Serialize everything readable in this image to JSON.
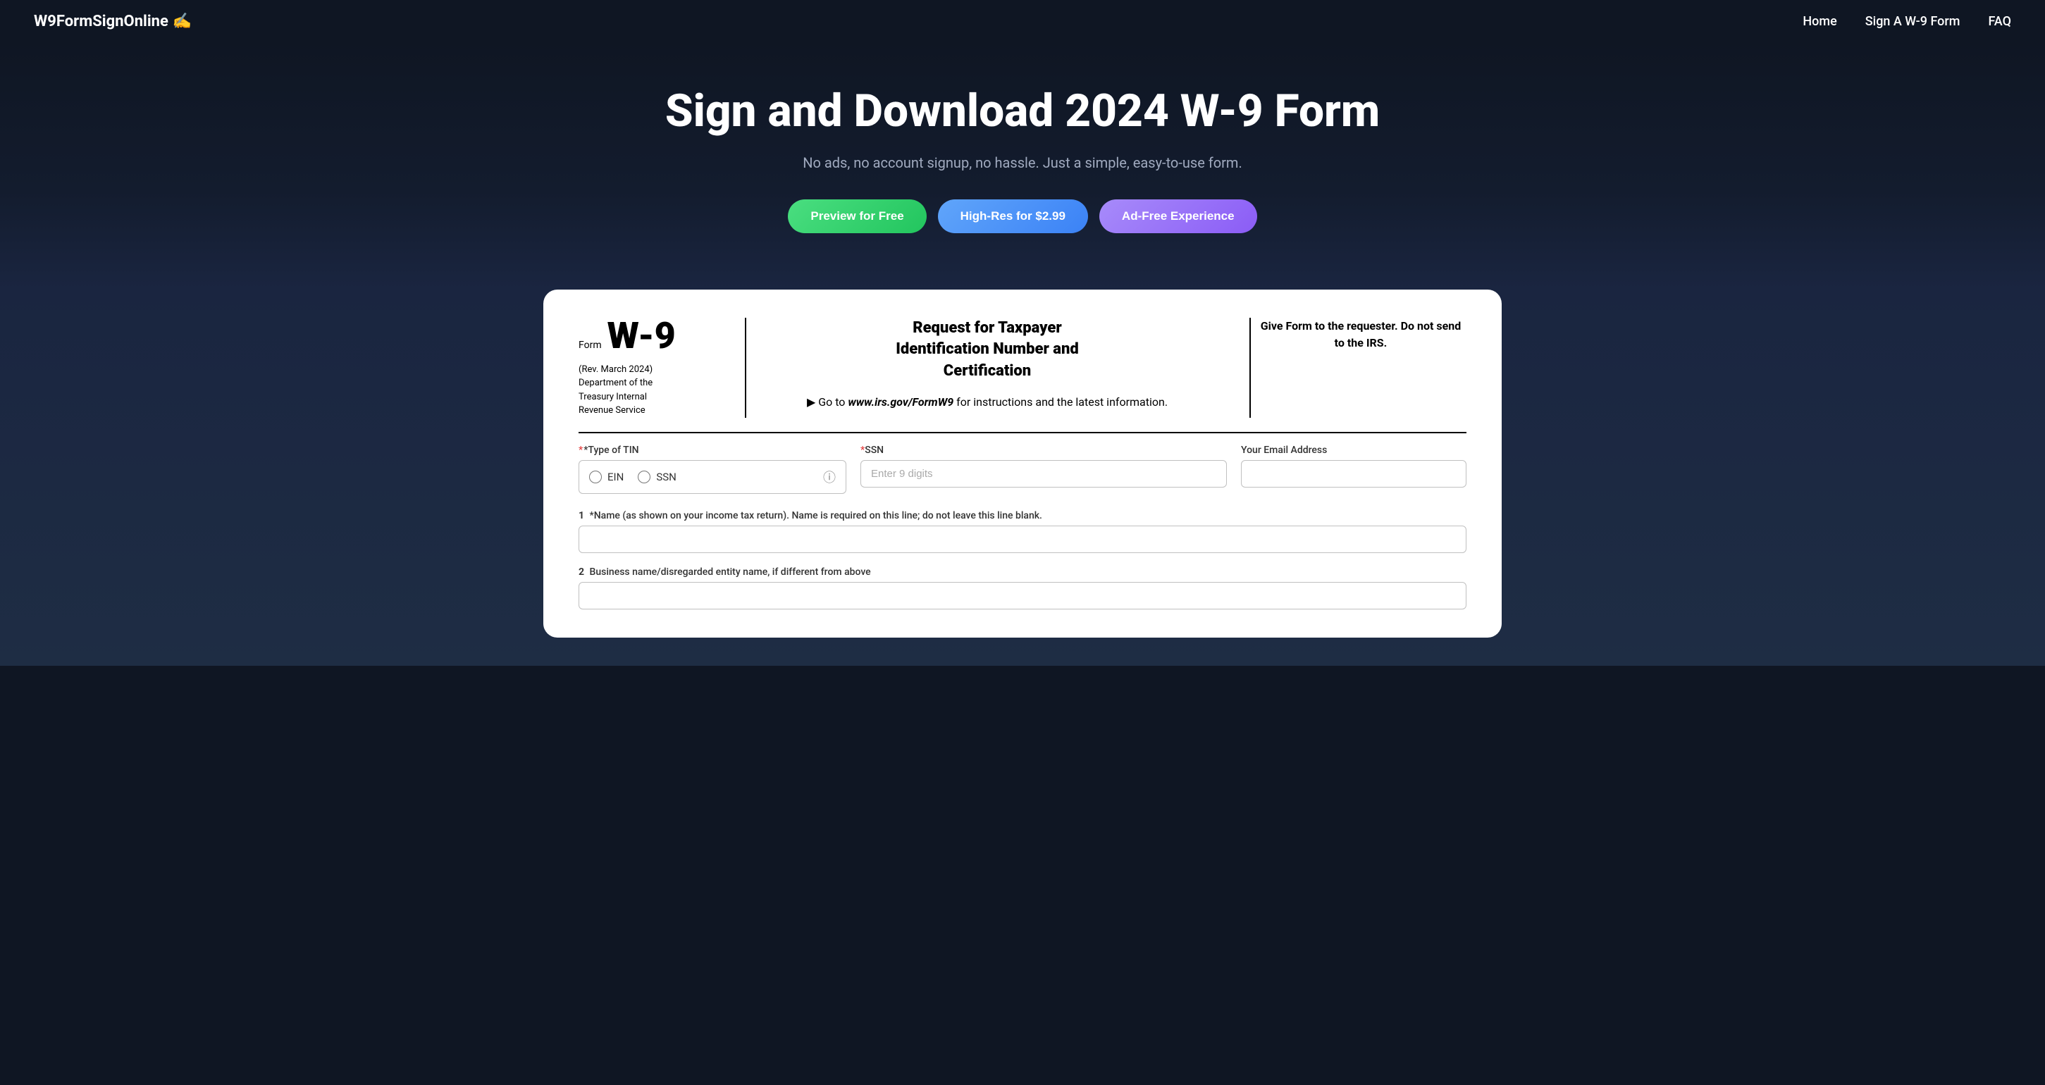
{
  "nav": {
    "logo_text": "W9FormSignOnline",
    "logo_icon": "✍️",
    "links": [
      {
        "label": "Home",
        "href": "#"
      },
      {
        "label": "Sign A W-9 Form",
        "href": "#"
      },
      {
        "label": "FAQ",
        "href": "#"
      }
    ]
  },
  "hero": {
    "title": "Sign and Download 2024 W-9 Form",
    "subtitle": "No ads, no account signup, no hassle. Just a simple, easy-to-use form.",
    "buttons": {
      "preview": "Preview for Free",
      "highres": "High-Res for $2.99",
      "adfree": "Ad-Free Experience"
    }
  },
  "form": {
    "form_label": "Form",
    "form_number": "W-9",
    "revision": "(Rev. March 2024)",
    "dept_line1": "Department of the",
    "dept_line2": "Treasury Internal",
    "dept_line3": "Revenue Service",
    "title_line1": "Request for Taxpayer",
    "title_line2": "Identification Number and",
    "title_line3": "Certification",
    "instruction_prefix": "▶ Go to",
    "instruction_url": "www.irs.gov/FormW9",
    "instruction_suffix": "for instructions and the latest information.",
    "give_form_text": "Give Form to the requester. Do not send to the IRS.",
    "tin_label": "*Type of TIN",
    "tin_required_star": "*",
    "ein_label": "EIN",
    "ssn_label": "SSN",
    "ssn_field_label": "*SSN",
    "ssn_placeholder": "Enter 9 digits",
    "email_label": "Your Email Address",
    "name_field_number": "1",
    "name_field_label": "*Name (as shown on your income tax return). Name is required on this line; do not leave this line blank.",
    "business_field_number": "2",
    "business_field_label": "Business name/disregarded entity name, if different from above"
  }
}
